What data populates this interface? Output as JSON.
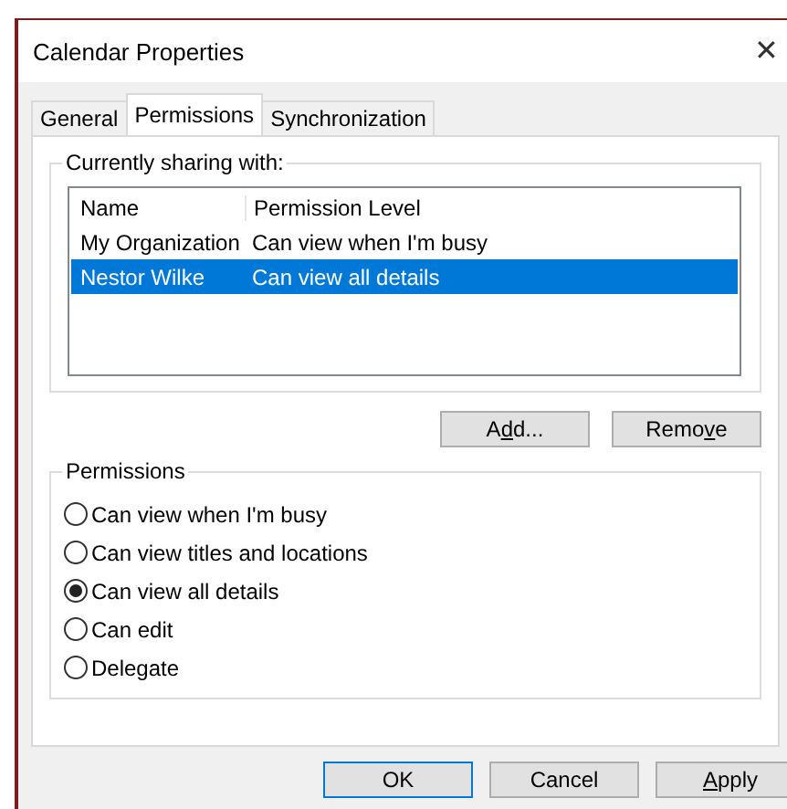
{
  "window": {
    "title": "Calendar Properties",
    "close": "✕"
  },
  "tabs": [
    {
      "label": "General",
      "selected": false
    },
    {
      "label": "Permissions",
      "selected": true
    },
    {
      "label": "Synchronization",
      "selected": false
    }
  ],
  "sharing": {
    "title": "Currently sharing with:",
    "columns": [
      "Name",
      "Permission Level"
    ],
    "rows": [
      {
        "cells": [
          "My Organization",
          "Can view when I'm busy"
        ],
        "selected": false
      },
      {
        "cells": [
          "Nestor Wilke",
          "Can view all details"
        ],
        "selected": true
      }
    ],
    "buttons": [
      {
        "before": "A",
        "key": "d",
        "after": "d..."
      },
      {
        "before": "Remo",
        "key": "v",
        "after": "e"
      }
    ]
  },
  "permissions": {
    "title": "Permissions",
    "options": [
      {
        "label": "Can view when I'm busy",
        "selected": false
      },
      {
        "label": "Can view titles and locations",
        "selected": false
      },
      {
        "label": "Can view all details",
        "selected": true
      },
      {
        "label": "Can edit",
        "selected": false
      },
      {
        "label": "Delegate",
        "selected": false
      }
    ]
  },
  "footer": [
    {
      "before": "OK",
      "default": true
    },
    {
      "before": "Cancel",
      "default": false
    },
    {
      "key": "A",
      "after": "pply",
      "default": false
    }
  ]
}
